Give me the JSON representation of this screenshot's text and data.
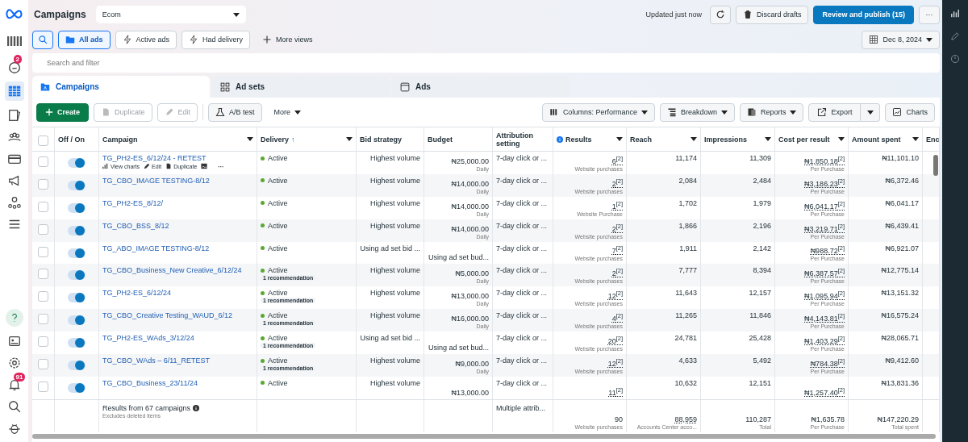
{
  "header": {
    "title": "Campaigns",
    "account": "Ecom",
    "updated": "Updated just now",
    "discard": "Discard drafts",
    "publish": "Review and publish (15)",
    "more": "···"
  },
  "views": [
    {
      "label": "All ads",
      "selected": true,
      "kind": "folder"
    },
    {
      "label": "Active ads",
      "selected": false,
      "kind": "bolt"
    },
    {
      "label": "Had delivery",
      "selected": false,
      "kind": "bolt"
    },
    {
      "label": "More views",
      "selected": false,
      "kind": "plus"
    }
  ],
  "date": "Dec 8, 2024",
  "search": {
    "placeholder": "Search and filter"
  },
  "nav": {
    "chat_badge": "2",
    "bell_badge": "91"
  },
  "tabs": [
    {
      "label": "Campaigns",
      "selected": true,
      "kind": "campaign"
    },
    {
      "label": "Ad sets",
      "selected": false,
      "kind": "adset"
    },
    {
      "label": "Ads",
      "selected": false,
      "kind": "ad"
    }
  ],
  "toolbar": {
    "create": "Create",
    "duplicate": "Duplicate",
    "edit": "Edit",
    "ab_test": "A/B test",
    "more": "More",
    "columns": "Columns: Performance",
    "breakdown": "Breakdown",
    "reports": "Reports",
    "export": "Export",
    "charts": "Charts"
  },
  "table": {
    "all_checked": false,
    "columns": [
      {
        "label": "Off / On",
        "menu": false
      },
      {
        "label": "Campaign",
        "menu": true
      },
      {
        "label": "Delivery",
        "sort": "↑",
        "menu": true
      },
      {
        "label": "Bid strategy",
        "menu": false
      },
      {
        "label": "Budget",
        "menu": false
      },
      {
        "label": "Attribution setting",
        "menu": false
      },
      {
        "label": "Results",
        "menu": true,
        "info": true
      },
      {
        "label": "Reach",
        "menu": true
      },
      {
        "label": "Impressions",
        "menu": true
      },
      {
        "label": "Cost per result",
        "menu": true
      },
      {
        "label": "Amount spent",
        "menu": true
      },
      {
        "label": "Enc",
        "menu": false
      }
    ],
    "row_actions": [
      "View charts",
      "Edit",
      "Duplicate",
      "···"
    ],
    "rows": [
      {
        "on": true,
        "checked": false,
        "campaign": "TG_PH2-ES_6/12/24 - RETEST",
        "delivery": "Active",
        "bid": "Highest volume",
        "budget": "₦25,000.00",
        "budget_period": "Daily",
        "attribution": "7-day click or ...",
        "results": "6$^{[2]}$",
        "results_label": "Website purchases",
        "reach": "11,174",
        "impressions": "11,309",
        "cost": "₦1,850.18$^{[2]}$",
        "cost_label": "Per Purchase",
        "spent": "₦11,101.10"
      },
      {
        "on": true,
        "checked": false,
        "campaign": "TG_CBO_IMAGE TESTING-8/12",
        "delivery": "Active",
        "bid": "Highest volume",
        "budget": "₦14,000.00",
        "budget_period": "Daily",
        "attribution": "7-day click or ...",
        "results": "2$^{[2]}$",
        "results_label": "Website purchases",
        "reach": "2,084",
        "impressions": "2,484",
        "cost": "₦3,186.23$^{[2]}$",
        "cost_label": "Per Purchase",
        "spent": "₦6,372.46"
      },
      {
        "on": true,
        "checked": false,
        "campaign": "TG_PH2-ES_8/12/",
        "delivery": "Active",
        "bid": "Highest volume",
        "budget": "₦14,000.00",
        "budget_period": "Daily",
        "attribution": "7-day click or ...",
        "results": "1$^{[2]}$",
        "results_label": "Website Purchase",
        "reach": "1,702",
        "impressions": "1,979",
        "cost": "₦6,041.17$^{[2]}$",
        "cost_label": "Per Purchase",
        "spent": "₦6,041.17"
      },
      {
        "on": true,
        "checked": false,
        "campaign": "TG_CBO_BSS_8/12",
        "delivery": "Active",
        "bid": "Highest volume",
        "budget": "₦14,000.00",
        "budget_period": "Daily",
        "attribution": "7-day click or ...",
        "results": "2$^{[2]}$",
        "results_label": "Website purchases",
        "reach": "1,866",
        "impressions": "2,196",
        "cost": "₦3,219.71$^{[2]}$",
        "cost_label": "Per Purchase",
        "spent": "₦6,439.41"
      },
      {
        "on": true,
        "checked": false,
        "campaign": "TG_ABO_IMAGE TESTING-8/12",
        "delivery": "Active",
        "bid": "Using ad set bid ...",
        "budget": "Using ad set bud...",
        "attribution": "7-day click or ...",
        "results": "7$^{[2]}$",
        "results_label": "Website purchases",
        "reach": "1,911",
        "impressions": "2,142",
        "cost": "₦988.72$^{[2]}$",
        "cost_label": "Per Purchase",
        "spent": "₦6,921.07"
      },
      {
        "on": true,
        "checked": false,
        "campaign": "TG_CBO_Business_New Creative_6/12/24",
        "delivery": "Active",
        "recommendation": "1 recommendation",
        "bid": "Highest volume",
        "budget": "₦5,000.00",
        "budget_period": "Daily",
        "attribution": "7-day click or ...",
        "results": "2$^{[2]}$",
        "results_label": "Website purchases",
        "reach": "7,777",
        "impressions": "8,394",
        "cost": "₦6,387.57$^{[2]}$",
        "cost_label": "Per Purchase",
        "spent": "₦12,775.14"
      },
      {
        "on": true,
        "checked": false,
        "campaign": "TG_PH2-ES_6/12/24",
        "delivery": "Active",
        "recommendation": "1 recommendation",
        "bid": "Highest volume",
        "budget": "₦13,000.00",
        "budget_period": "Daily",
        "attribution": "7-day click or ...",
        "results": "12$^{[2]}$",
        "results_label": "Website purchases",
        "reach": "11,643",
        "impressions": "12,157",
        "cost": "₦1,095.94$^{[2]}$",
        "cost_label": "Per Purchase",
        "spent": "₦13,151.32"
      },
      {
        "on": true,
        "checked": false,
        "campaign": "TG_CBO_Creative Testing_WAUD_6/12",
        "delivery": "Active",
        "recommendation": "1 recommendation",
        "bid": "Highest volume",
        "budget": "₦16,000.00",
        "budget_period": "Daily",
        "attribution": "7-day click or ...",
        "results": "4$^{[2]}$",
        "results_label": "Website purchases",
        "reach": "11,265",
        "impressions": "11,846",
        "cost": "₦4,143.81$^{[2]}$",
        "cost_label": "Per Purchase",
        "spent": "₦16,575.24"
      },
      {
        "on": true,
        "checked": false,
        "campaign": "TG_PH2-ES_WAds_3/12/24",
        "delivery": "Active",
        "recommendation": "1 recommendation",
        "bid": "Using ad set bid ...",
        "budget": "Using ad set bud...",
        "attribution": "7-day click or ...",
        "results": "20$^{[2]}$",
        "results_label": "Website purchases",
        "reach": "24,781",
        "impressions": "25,428",
        "cost": "₦1,403.29$^{[2]}$",
        "cost_label": "Per Purchase",
        "spent": "₦28,065.71"
      },
      {
        "on": true,
        "checked": false,
        "campaign": "TG_CBO_WAds – 6/11_RETEST",
        "delivery": "Active",
        "recommendation": "1 recommendation",
        "bid": "Highest volume",
        "budget": "₦9,000.00",
        "budget_period": "Daily",
        "attribution": "7-day click or ...",
        "results": "12$^{[2]}$",
        "results_label": "Website purchases",
        "reach": "4,633",
        "impressions": "5,492",
        "cost": "₦784.38$^{[2]}$",
        "cost_label": "Per Purchase",
        "spent": "₦9,412.60"
      },
      {
        "on": true,
        "checked": false,
        "campaign": "TG_CBO_Business_23/11/24",
        "delivery": "Active",
        "bid": "Highest volume",
        "budget": "₦13,000.00",
        "attribution": "7-day click or ...",
        "results": "11$^{[2]}$",
        "reach": "10,632",
        "impressions": "12,151",
        "cost": "₦1,257.40$^{[2]}$",
        "spent": "₦13,831.36"
      }
    ],
    "footer": {
      "summary": "Results from 67 campaigns",
      "note": "Excludes deleted items",
      "attribution": "Multiple attrib...",
      "results": "90",
      "results_label": "Website purchases",
      "reach": "88,959",
      "reach_label": "Accounts Center acco...",
      "impressions": "110,287",
      "impressions_label": "Total",
      "cost": "₦1,635.78",
      "cost_label": "Per Purchase",
      "spent": "₦147,220.29",
      "spent_label": "Total spent"
    }
  }
}
